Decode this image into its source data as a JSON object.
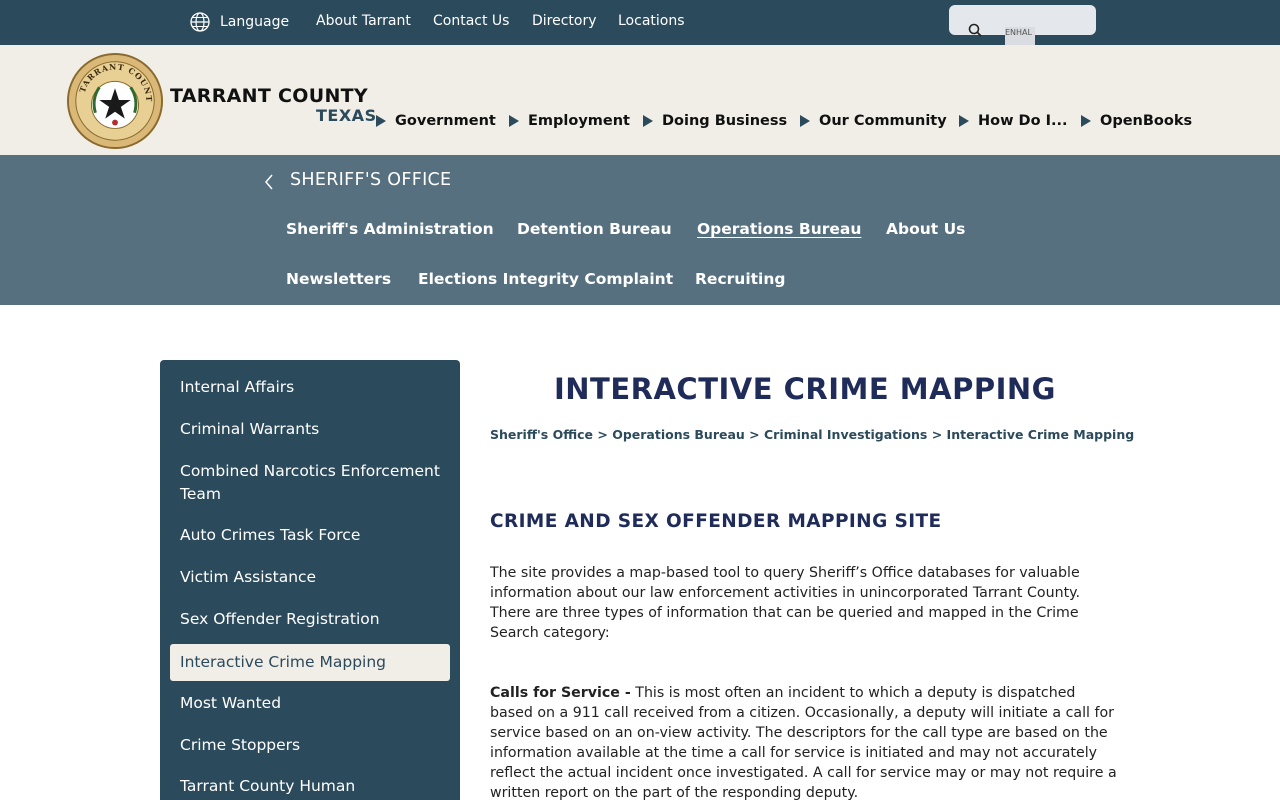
{
  "topbar": {
    "language": "Language",
    "links": [
      "About Tarrant",
      "Contact Us",
      "Directory",
      "Locations"
    ],
    "search_label": "ENHAL"
  },
  "header": {
    "brand_name": "TARRANT COUNTY",
    "brand_state": "TEXAS",
    "nav": [
      "Government",
      "Employment",
      "Doing Business",
      "Our Community",
      "How Do I...",
      "OpenBooks"
    ]
  },
  "section": {
    "title": "SHERIFF'S OFFICE",
    "nav": [
      "Sheriff's Administration",
      "Detention Bureau",
      "Operations Bureau",
      "About Us",
      "Newsletters",
      "Elections Integrity Complaint",
      "Recruiting"
    ],
    "active": "Operations Bureau"
  },
  "sidebar": {
    "items": [
      "Internal Affairs",
      "Criminal Warrants",
      "Combined Narcotics Enforcement Team",
      "Auto Crimes Task Force",
      "Victim Assistance",
      "Sex Offender Registration",
      "Interactive Crime Mapping",
      "Most Wanted",
      "Crime Stoppers",
      "Tarrant County Human"
    ],
    "current": "Interactive Crime Mapping"
  },
  "main": {
    "title": "INTERACTIVE CRIME MAPPING",
    "breadcrumb": [
      "Sheriff's Office",
      "Operations Bureau",
      "Criminal Investigations",
      "Interactive Crime Mapping"
    ],
    "heading": "CRIME AND SEX OFFENDER MAPPING SITE",
    "intro": "The site provides a map-based tool to query Sheriff’s Office databases for valuable information about our law enforcement activities in unincorporated Tarrant County. There are three types of information that can be queried and mapped in the Crime Search category:",
    "calls_label": "Calls for Service -",
    "calls_text": " This is most often an incident to which a deputy is dispatched based on a 911 call received from a citizen. Occasionally, a deputy will initiate a call for service based on an on-view activity. The descriptors for the call type are based on the information available at the time a call for service is initiated and may not accurately reflect the actual incident once investigated. A call for service may or may not require a written report on the part of the responding deputy."
  },
  "colors": {
    "topbar": "#2b4a5c",
    "header_bg": "#f1eee8",
    "section_bg": "#56707f",
    "sidebar_bg": "#2b4a5c",
    "title": "#1f2c5a"
  }
}
